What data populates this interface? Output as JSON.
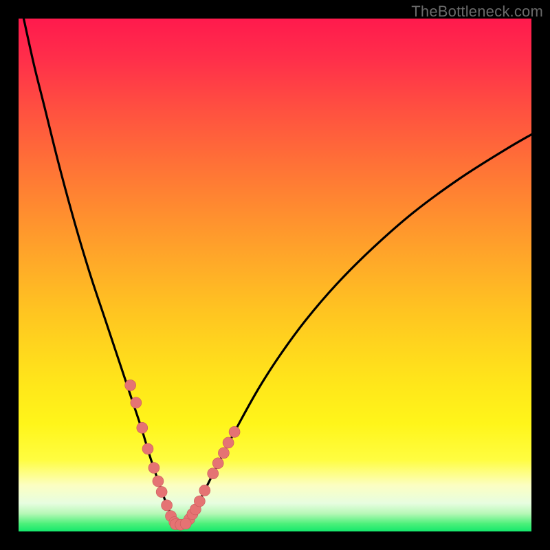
{
  "watermark": {
    "text": "TheBottleneck.com"
  },
  "chart_data": {
    "type": "line",
    "title": "",
    "xlabel": "",
    "ylabel": "",
    "xlim": [
      0,
      100
    ],
    "ylim": [
      0,
      100
    ],
    "grid": false,
    "legend": false,
    "series": [
      {
        "name": "bottleneck-curve",
        "x": [
          1,
          3,
          5,
          8,
          11,
          14,
          17,
          20,
          22,
          24,
          25.5,
          27,
          28.3,
          29.3,
          30.2,
          31,
          32,
          33.2,
          34.5,
          36,
          38,
          40.5,
          43.5,
          47,
          51,
          56,
          62,
          69,
          77,
          86,
          95,
          100
        ],
        "y": [
          100,
          91,
          83,
          71,
          60,
          50,
          41,
          32,
          26,
          20,
          15,
          10.5,
          6.8,
          4.2,
          2.4,
          1.4,
          1.3,
          2.2,
          4.3,
          7.4,
          11.4,
          16.3,
          22,
          28.2,
          34.4,
          41.2,
          48.2,
          55.2,
          62.2,
          68.8,
          74.5,
          77.4
        ]
      }
    ],
    "points": [
      {
        "name": "left-branch-dots",
        "x": [
          21.8,
          22.9,
          24.1,
          25.2,
          26.4,
          27.2,
          27.9,
          28.9,
          29.7,
          30.4
        ],
        "y": [
          28.5,
          25.1,
          20.2,
          16.1,
          12.4,
          9.8,
          7.7,
          5.1,
          3.0,
          1.8
        ]
      },
      {
        "name": "right-branch-dots",
        "x": [
          33.3,
          33.9,
          34.5,
          35.3,
          36.3,
          37.9,
          38.9,
          40.0,
          40.9,
          42.1
        ],
        "y": [
          2.4,
          3.4,
          4.3,
          5.9,
          8.0,
          11.3,
          13.3,
          15.3,
          17.3,
          19.4
        ]
      },
      {
        "name": "floor-dots",
        "x": [
          30.6,
          31.6,
          32.6
        ],
        "y": [
          1.4,
          1.3,
          1.5
        ]
      }
    ],
    "colors": {
      "curve": "#000000",
      "dots": "#e57373",
      "gradient_top": "#ff1a4d",
      "gradient_bottom": "#15e86c"
    }
  }
}
